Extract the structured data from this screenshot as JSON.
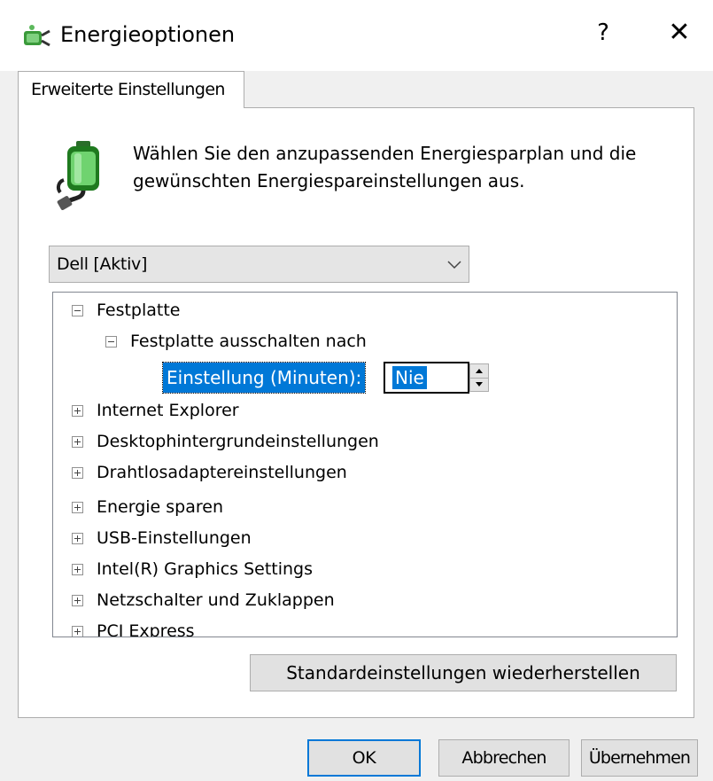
{
  "window": {
    "title": "Energieoptionen",
    "help_label": "?",
    "close_label": "✕"
  },
  "tab": {
    "label": "Erweiterte Einstellungen"
  },
  "intro_text": "Wählen Sie den anzupassenden Energiesparplan und die gewünschten Energiespareinstellungen aus.",
  "plan_select": {
    "selected": "Dell [Aktiv]"
  },
  "tree": {
    "items": [
      {
        "label": "Festplatte",
        "expanded": true
      },
      {
        "label": "Festplatte ausschalten nach",
        "expanded": true
      },
      {
        "label": "Internet Explorer",
        "expanded": false
      },
      {
        "label": "Desktophintergrundeinstellungen",
        "expanded": false
      },
      {
        "label": "Drahtlosadaptereinstellungen",
        "expanded": false
      },
      {
        "label": "Energie sparen",
        "expanded": false
      },
      {
        "label": "USB-Einstellungen",
        "expanded": false
      },
      {
        "label": "Intel(R) Graphics Settings",
        "expanded": false
      },
      {
        "label": "Netzschalter und Zuklappen",
        "expanded": false
      },
      {
        "label": "PCI Express",
        "expanded": false
      }
    ],
    "setting": {
      "label": "Einstellung (Minuten):",
      "value": "Nie"
    }
  },
  "buttons": {
    "restore": "Standardeinstellungen wiederherstellen",
    "ok": "OK",
    "cancel": "Abbrechen",
    "apply": "Übernehmen"
  },
  "icons": {
    "app": "power-options-icon",
    "battery": "battery-plug-icon"
  },
  "colors": {
    "selection": "#0078d7",
    "accent_border": "#0078d7"
  }
}
